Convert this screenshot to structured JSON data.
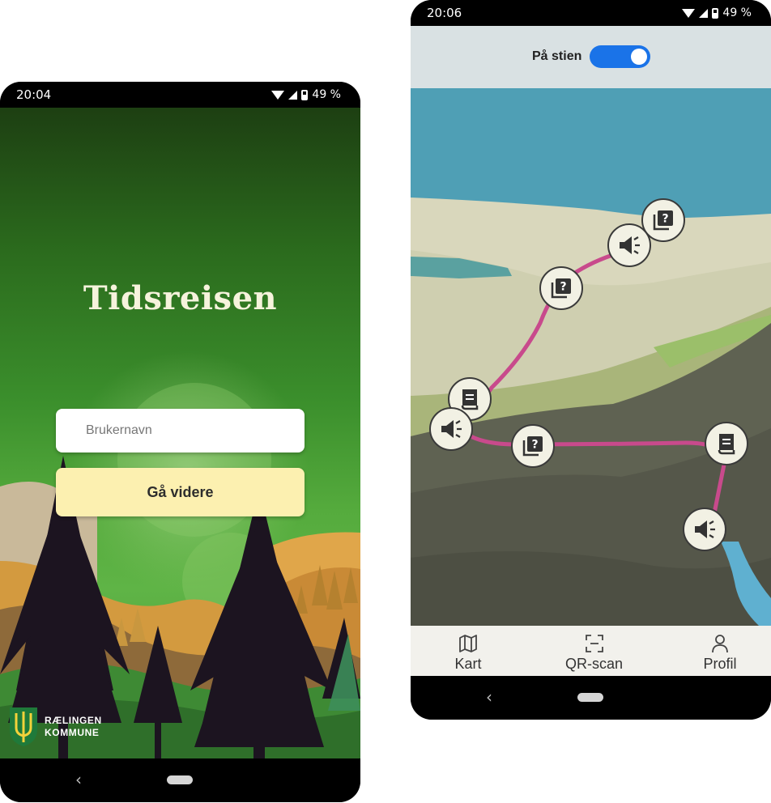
{
  "login_phone": {
    "status": {
      "time": "20:04",
      "battery": "49 %"
    },
    "app_title": "Tidsreisen",
    "username": {
      "value": "",
      "placeholder": "Brukernavn"
    },
    "continue_label": "Gå videre",
    "logo": {
      "line1": "RÆLINGEN",
      "line2": "KOMMUNE"
    },
    "nav": {
      "back": "‹"
    }
  },
  "map_phone": {
    "status": {
      "time": "20:06",
      "battery": "49 %"
    },
    "toggle": {
      "label": "På stien",
      "on": true
    },
    "markers": [
      {
        "icon": "quiz-icon"
      },
      {
        "icon": "audio-icon"
      },
      {
        "icon": "quiz-icon"
      },
      {
        "icon": "book-icon"
      },
      {
        "icon": "audio-icon"
      },
      {
        "icon": "quiz-icon"
      },
      {
        "icon": "book-icon"
      },
      {
        "icon": "audio-icon"
      }
    ],
    "bottom_nav": [
      {
        "label": "Kart",
        "icon": "map-icon"
      },
      {
        "label": "QR-scan",
        "icon": "qr-scan-icon"
      },
      {
        "label": "Profil",
        "icon": "profile-icon"
      }
    ],
    "nav": {
      "back": "‹"
    }
  },
  "colors": {
    "forest_green": "#3b8f2c",
    "button_yellow": "#fcf0b0",
    "toggle_blue": "#1a73e8",
    "trail_pink": "#c84a8c",
    "water_blue": "#4f9fb5"
  }
}
